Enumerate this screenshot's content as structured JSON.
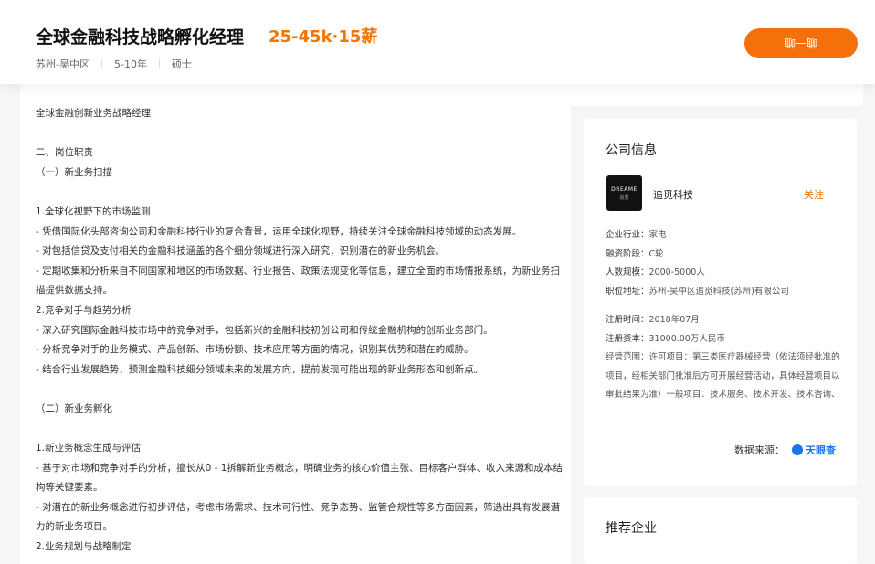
{
  "job": {
    "title": "全球金融科技战略孵化经理",
    "salary": "25-45k·15薪",
    "location": "苏州-吴中区",
    "experience": "5-10年",
    "education": "硕士",
    "chat_button": "聊一聊"
  },
  "description": [
    "全球金融创新业务战略经理",
    "",
    "二、岗位职责",
    "（一）新业务扫描",
    "",
    "1.全球化视野下的市场监测",
    " - 凭借国际化头部咨询公司和金融科技行业的复合背景，运用全球化视野，持续关注全球金融科技领域的动态发展。",
    " - 对包括信贷及支付相关的金融科技涵盖的各个细分领域进行深入研究，识别潜在的新业务机会。",
    " - 定期收集和分析来自不同国家和地区的市场数据、行业报告、政策法规变化等信息，建立全面的市场情报系统，为新业务扫描提供数据支持。",
    "2.竞争对手与趋势分析",
    " - 深入研究国际金融科技市场中的竞争对手，包括新兴的金融科技初创公司和传统金融机构的创新业务部门。",
    " - 分析竞争对手的业务模式、产品创新、市场份额、技术应用等方面的情况，识别其优势和潜在的威胁。",
    " - 结合行业发展趋势，预测金融科技细分领域未来的发展方向，提前发现可能出现的新业务形态和创新点。",
    "",
    "（二）新业务孵化",
    "",
    "1.新业务概念生成与评估",
    " - 基于对市场和竞争对手的分析，擅长从0 - 1拆解新业务概念，明确业务的核心价值主张、目标客户群体、收入来源和成本结构等关键要素。",
    " - 对潜在的新业务概念进行初步评估，考虑市场需求、技术可行性、竞争态势、监管合规性等多方面因素，筛选出具有发展潜力的新业务项目。",
    "2.业务规划与战略制定"
  ],
  "company": {
    "section_title": "公司信息",
    "logo_text": "DREAME",
    "logo_sub": "追觅",
    "name": "追觅科技",
    "follow": "关注",
    "industry_label": "企业行业：",
    "industry": "家电",
    "stage_label": "融资阶段：",
    "stage": "C轮",
    "size_label": "人数规模：",
    "size": "2000-5000人",
    "address_label": "职位地址：",
    "address": "苏州-吴中区追觅科技(苏州)有限公司",
    "reg_time_label": "注册时间：",
    "reg_time": "2018年07月",
    "reg_capital_label": "注册资本：",
    "reg_capital": "31000.00万人民币",
    "scope_label": "经营范围：",
    "scope": "许可项目：第三类医疗器械经营（依法须经批准的项目，经相关部门批准后方可开展经营活动，具体经营项目以审批结果为准）一般项目：技术服务、技术开发、技术咨询、技术交流、技术转让、技术推广；工业互联网数据...",
    "source_label": "数据来源：",
    "source": "天眼查"
  },
  "recommend": {
    "title": "推荐企业"
  }
}
